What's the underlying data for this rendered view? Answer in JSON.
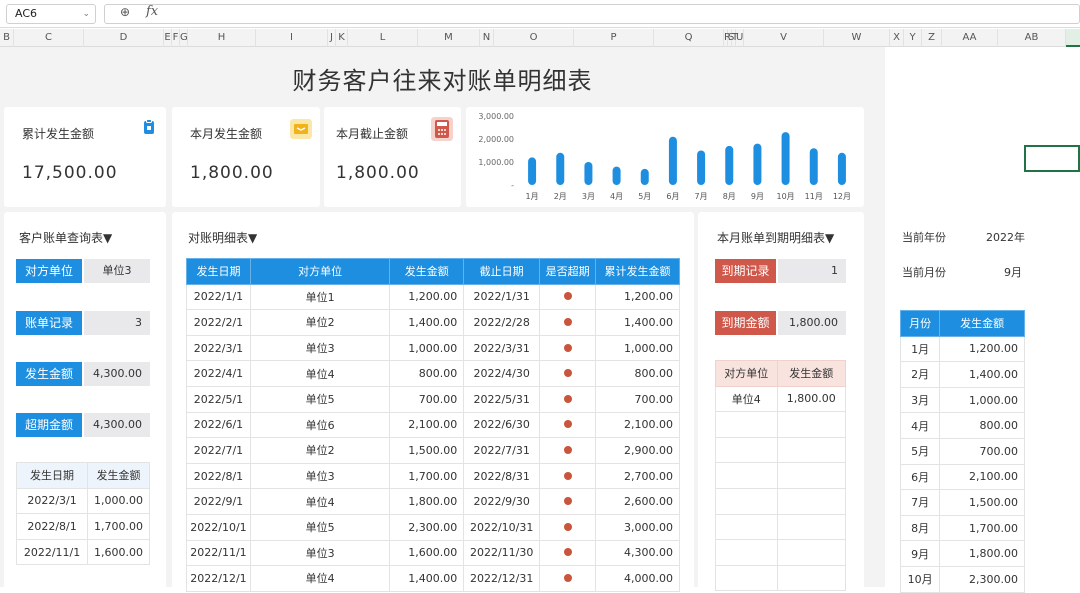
{
  "namebox": {
    "value": "AC6"
  },
  "formula_bar": {
    "fx": "fx",
    "value": ""
  },
  "columns": [
    "B",
    "C",
    "D",
    "E",
    "F",
    "G",
    "H",
    "I",
    "J",
    "K",
    "L",
    "M",
    "N",
    "O",
    "P",
    "Q",
    "R",
    "S",
    "T",
    "U",
    "V",
    "W",
    "X",
    "Y",
    "Z",
    "AA",
    "AB",
    "AC"
  ],
  "selected_column": "AC",
  "title": "财务客户往来对账单明细表",
  "kpis": [
    {
      "label": "累计发生金额",
      "value": "17,500.00",
      "icon": "clipboard-icon",
      "color": "#1e8fe0"
    },
    {
      "label": "本月发生金额",
      "value": "1,800.00",
      "icon": "ticket-icon",
      "color": "#f2b21c"
    },
    {
      "label": "本月截止金额",
      "value": "1,800.00",
      "icon": "calculator-icon",
      "color": "#d0584a"
    }
  ],
  "chart_data": {
    "type": "bar",
    "categories": [
      "1月",
      "2月",
      "3月",
      "4月",
      "5月",
      "6月",
      "7月",
      "8月",
      "9月",
      "10月",
      "11月",
      "12月"
    ],
    "values": [
      1200,
      1400,
      1000,
      800,
      700,
      2100,
      1500,
      1700,
      1800,
      2300,
      1600,
      1400
    ],
    "y_ticks": [
      "3,000.00",
      "2,000.00",
      "1,000.00",
      "-"
    ],
    "ylim": [
      0,
      3000
    ],
    "color": "#1e8fe0"
  },
  "query": {
    "title": "客户账单查询表▼",
    "party_label": "对方单位",
    "party_value": "单位3",
    "records_label": "账单记录",
    "records_value": "3",
    "amount_label": "发生金额",
    "amount_value": "4,300.00",
    "overdue_label": "超期金额",
    "overdue_value": "4,300.00",
    "mini_headers": [
      "发生日期",
      "发生金额"
    ],
    "mini_rows": [
      [
        "2022/3/1",
        "1,000.00"
      ],
      [
        "2022/8/1",
        "1,700.00"
      ],
      [
        "2022/11/1",
        "1,600.00"
      ]
    ]
  },
  "detail": {
    "title": "对账明细表▼",
    "headers": [
      "发生日期",
      "对方单位",
      "发生金额",
      "截止日期",
      "是否超期",
      "累计发生金额"
    ],
    "rows": [
      [
        "2022/1/1",
        "单位1",
        "1,200.00",
        "2022/1/31",
        "●",
        "1,200.00"
      ],
      [
        "2022/2/1",
        "单位2",
        "1,400.00",
        "2022/2/28",
        "●",
        "1,400.00"
      ],
      [
        "2022/3/1",
        "单位3",
        "1,000.00",
        "2022/3/31",
        "●",
        "1,000.00"
      ],
      [
        "2022/4/1",
        "单位4",
        "800.00",
        "2022/4/30",
        "●",
        "800.00"
      ],
      [
        "2022/5/1",
        "单位5",
        "700.00",
        "2022/5/31",
        "●",
        "700.00"
      ],
      [
        "2022/6/1",
        "单位6",
        "2,100.00",
        "2022/6/30",
        "●",
        "2,100.00"
      ],
      [
        "2022/7/1",
        "单位2",
        "1,500.00",
        "2022/7/31",
        "●",
        "2,900.00"
      ],
      [
        "2022/8/1",
        "单位3",
        "1,700.00",
        "2022/8/31",
        "●",
        "2,700.00"
      ],
      [
        "2022/9/1",
        "单位4",
        "1,800.00",
        "2022/9/30",
        "●",
        "2,600.00"
      ],
      [
        "2022/10/1",
        "单位5",
        "2,300.00",
        "2022/10/31",
        "●",
        "3,000.00"
      ],
      [
        "2022/11/1",
        "单位3",
        "1,600.00",
        "2022/11/30",
        "●",
        "4,300.00"
      ],
      [
        "2022/12/1",
        "单位4",
        "1,400.00",
        "2022/12/31",
        "●",
        "4,000.00"
      ]
    ]
  },
  "due": {
    "title": "本月账单到期明细表▼",
    "records_label": "到期记录",
    "records_value": "1",
    "amount_label": "到期金额",
    "amount_value": "1,800.00",
    "headers": [
      "对方单位",
      "发生金额"
    ],
    "rows": [
      [
        "单位4",
        "1,800.00"
      ]
    ]
  },
  "side": {
    "year_label": "当前年份",
    "year_value": "2022年",
    "month_label": "当前月份",
    "month_value": "9月",
    "headers": [
      "月份",
      "发生金额"
    ],
    "rows": [
      [
        "1月",
        "1,200.00"
      ],
      [
        "2月",
        "1,400.00"
      ],
      [
        "3月",
        "1,000.00"
      ],
      [
        "4月",
        "800.00"
      ],
      [
        "5月",
        "700.00"
      ],
      [
        "6月",
        "2,100.00"
      ],
      [
        "7月",
        "1,500.00"
      ],
      [
        "8月",
        "1,700.00"
      ],
      [
        "9月",
        "1,800.00"
      ],
      [
        "10月",
        "2,300.00"
      ]
    ]
  }
}
